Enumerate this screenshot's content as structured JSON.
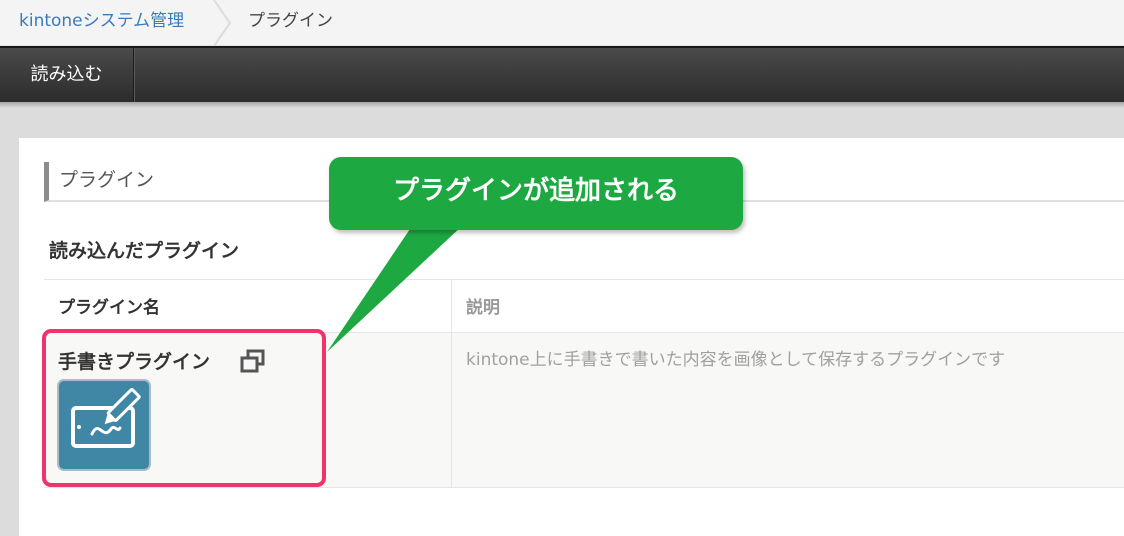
{
  "breadcrumb": {
    "root": "kintoneシステム管理",
    "current": "プラグイン"
  },
  "toolbar": {
    "import_label": "読み込む"
  },
  "section": {
    "title": "プラグイン",
    "subheading": "読み込んだプラグイン"
  },
  "table": {
    "headers": [
      "プラグイン名",
      "説明"
    ],
    "rows": [
      {
        "name": "手書きプラグイン",
        "description": "kintone上に手書きで書いた内容を画像として保存するプラグインです",
        "icon": "tablet-pen-icon"
      }
    ]
  },
  "annotation": {
    "callout": "プラグインが追加される"
  },
  "colors": {
    "link": "#3b7ab8",
    "toolbar": "#333333",
    "callout": "#1da842",
    "highlight": "#f0336b",
    "plugin_icon_bg": "#3f87a4"
  }
}
